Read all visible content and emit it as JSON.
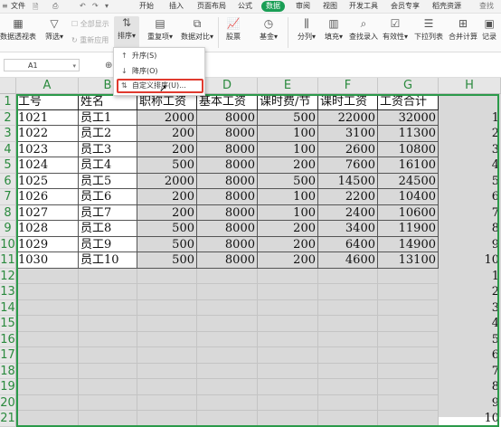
{
  "menu": {
    "quick_access": [
      "≡",
      "文件",
      "🗎",
      "⎙",
      "↶",
      "↷",
      "▾"
    ],
    "tabs": [
      "开始",
      "插入",
      "页面布局",
      "公式",
      "数据",
      "审阅",
      "视图",
      "开发工具",
      "会员专享",
      "稻壳资源",
      "查找"
    ],
    "active_tab": "数据"
  },
  "ribbon": {
    "pivot": "数据透视表",
    "filter": "筛选",
    "show_all": "全部显示",
    "reapply": "重新应用",
    "sort": "排序",
    "duplicates": "重复项",
    "compare": "数据对比",
    "stocks": "股票",
    "fund": "基金",
    "split": "分列",
    "fill": "填充",
    "lookup": "查找录入",
    "validity": "有效性",
    "dropdown_list": "下拉列表",
    "consolidate": "合并计算",
    "record": "记录"
  },
  "formula_bar": {
    "cell_ref": "A1",
    "zoom_icon": "⊕"
  },
  "sort_menu": {
    "items": [
      "升序(S)",
      "降序(O)",
      "自定义排序(U)..."
    ],
    "highlighted": "自定义排序(U)..."
  },
  "sheet": {
    "columns": [
      "A",
      "B",
      "C",
      "D",
      "E",
      "F",
      "G",
      "H"
    ],
    "row_numbers": [
      "1",
      "2",
      "3",
      "4",
      "5",
      "6",
      "7",
      "8",
      "9",
      "10",
      "11",
      "12",
      "13",
      "14",
      "15",
      "16",
      "17",
      "18",
      "19",
      "20",
      "21"
    ],
    "header_row": [
      "工号",
      "姓名",
      "职称工资",
      "基本工资",
      "课时费/节",
      "课时工资",
      "工资合计"
    ],
    "rows": [
      [
        "1021",
        "员工1",
        "2000",
        "8000",
        "500",
        "22000",
        "32000"
      ],
      [
        "1022",
        "员工2",
        "200",
        "8000",
        "100",
        "3100",
        "11300"
      ],
      [
        "1023",
        "员工3",
        "200",
        "8000",
        "100",
        "2600",
        "10800"
      ],
      [
        "1024",
        "员工4",
        "500",
        "8000",
        "200",
        "7600",
        "16100"
      ],
      [
        "1025",
        "员工5",
        "2000",
        "8000",
        "500",
        "14500",
        "24500"
      ],
      [
        "1026",
        "员工6",
        "200",
        "8000",
        "100",
        "2200",
        "10400"
      ],
      [
        "1027",
        "员工7",
        "200",
        "8000",
        "100",
        "2400",
        "10600"
      ],
      [
        "1028",
        "员工8",
        "500",
        "8000",
        "200",
        "3400",
        "11900"
      ],
      [
        "1029",
        "员工9",
        "500",
        "8000",
        "200",
        "6400",
        "14900"
      ],
      [
        "1030",
        "员工10",
        "500",
        "8000",
        "200",
        "4600",
        "13100"
      ]
    ],
    "h_values": [
      "",
      "1",
      "2",
      "3",
      "4",
      "5",
      "6",
      "7",
      "8",
      "9",
      "10",
      "1",
      "2",
      "3",
      "4",
      "5",
      "6",
      "7",
      "8",
      "9",
      "10"
    ]
  },
  "colors": {
    "accent": "#1a9e55",
    "selection": "#2b9a4a",
    "highlight_box": "#e03a2f"
  }
}
